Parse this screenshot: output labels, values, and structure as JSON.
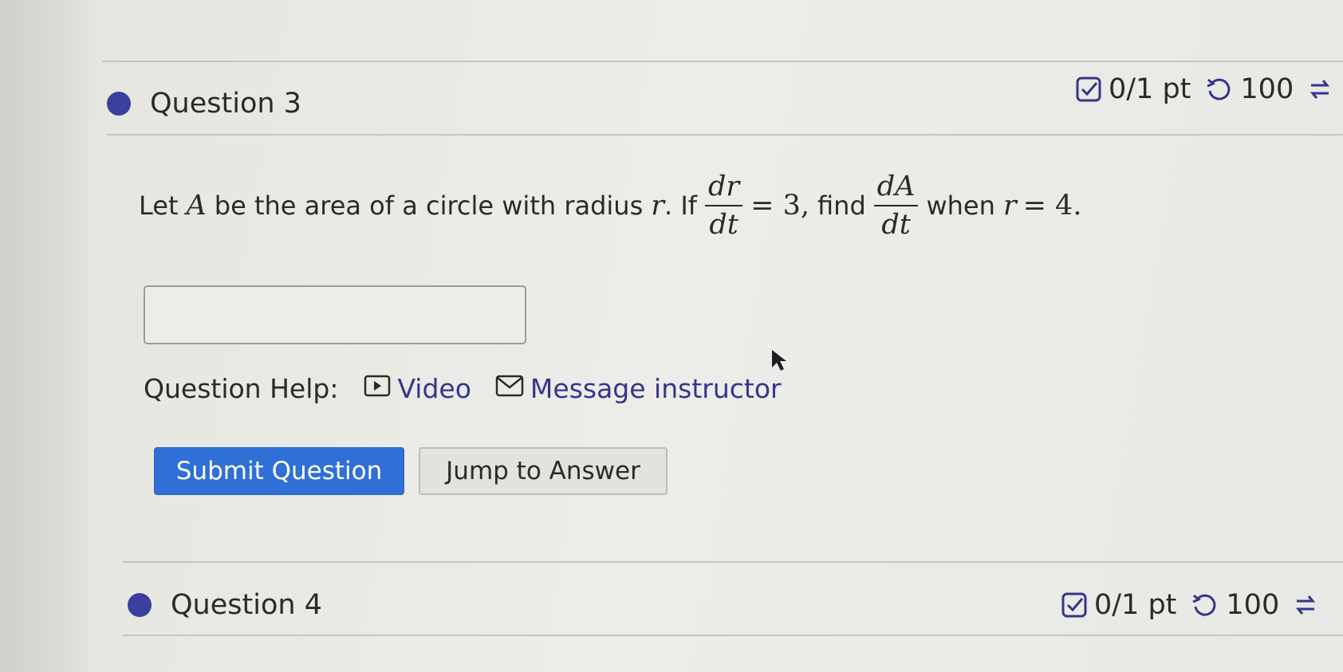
{
  "question3": {
    "title": "Question 3",
    "score": "0/1 pt",
    "attempts": "100",
    "prompt": {
      "intro": "Let",
      "var_A": "A",
      "text1": "be the area of a circle with radius",
      "var_r": "r",
      "text2": ". If",
      "frac1_num": "dr",
      "frac1_den": "dt",
      "equals3": "= 3,",
      "text3": "find",
      "frac2_num": "dA",
      "frac2_den": "dt",
      "text4": "when",
      "var_r2": "r",
      "equals4": "= 4."
    },
    "answer_value": "",
    "help_label": "Question Help:",
    "video_label": "Video",
    "message_label": "Message instructor",
    "submit_label": "Submit Question",
    "jump_label": "Jump to Answer"
  },
  "question4": {
    "title": "Question 4",
    "score": "0/1 pt",
    "attempts": "100"
  },
  "colors": {
    "accent_dot": "#3b3f9e",
    "submit_button": "#2f6fd6",
    "link": "#33368a"
  },
  "icons": {
    "score": "checkbox-icon",
    "attempts": "retry-icon",
    "regenerate": "regenerate-icon",
    "video": "play-icon",
    "message": "mail-icon"
  }
}
